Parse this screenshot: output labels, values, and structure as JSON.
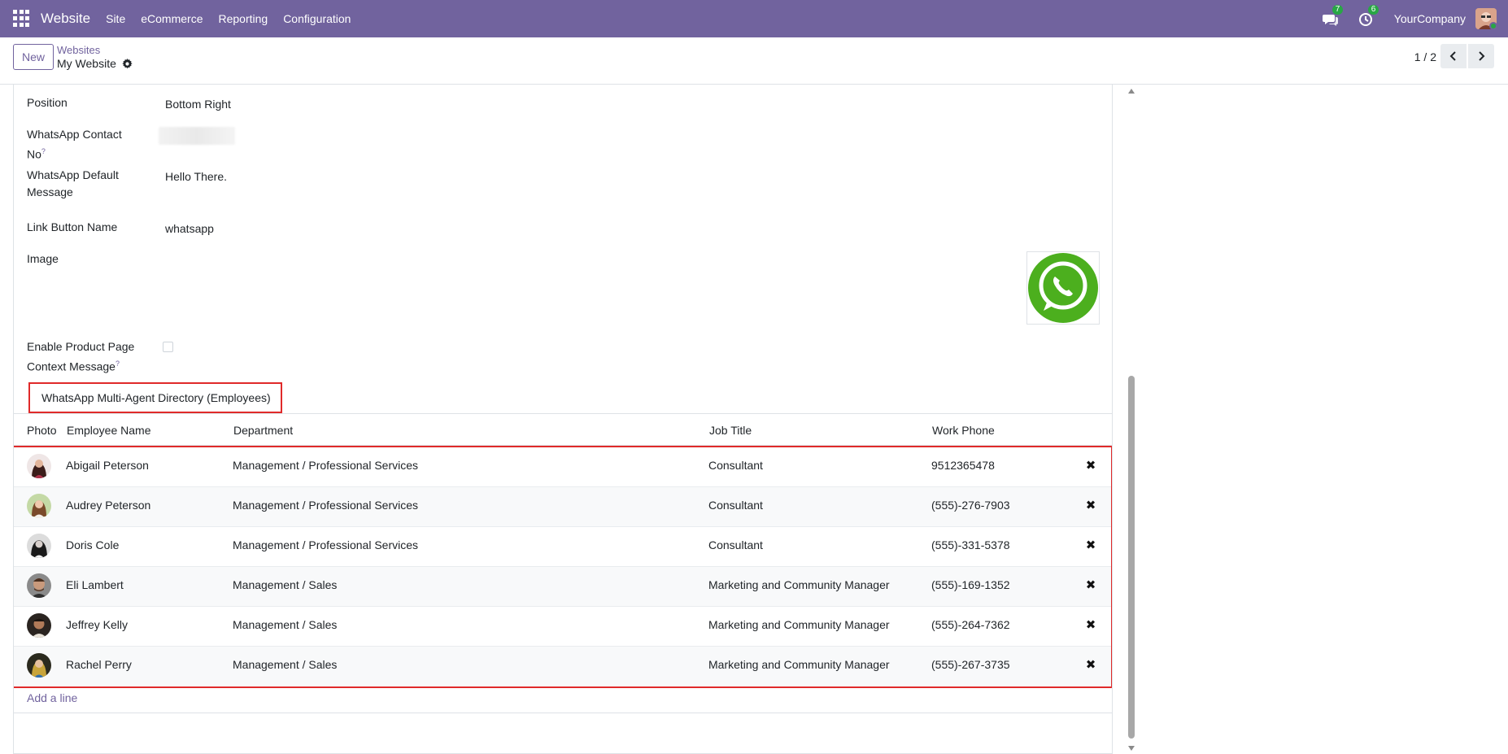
{
  "navbar": {
    "brand": "Website",
    "menu": [
      "Site",
      "eCommerce",
      "Reporting",
      "Configuration"
    ],
    "messages_badge": "7",
    "activities_badge": "6",
    "company": "YourCompany",
    "bg_color": "#71639e"
  },
  "control_panel": {
    "new_label": "New",
    "breadcrumb": "Websites",
    "record_title": "My Website",
    "pager": "1 / 2"
  },
  "form": {
    "position_label": "Position",
    "position_value": "Bottom Right",
    "contact_label": "WhatsApp Contact No",
    "contact_help": "?",
    "default_msg_label": "WhatsApp Default Message",
    "default_msg_value": "Hello There.",
    "link_name_label": "Link Button Name",
    "link_name_value": "whatsapp",
    "image_label": "Image",
    "product_msg_label": "Enable Product Page Context Message",
    "product_msg_help": "?",
    "section_title": "WhatsApp Multi-Agent Directory (Employees)"
  },
  "table": {
    "headers": {
      "photo": "Photo",
      "name": "Employee Name",
      "department": "Department",
      "job": "Job Title",
      "phone": "Work Phone"
    },
    "rows": [
      {
        "name": "Abigail Peterson",
        "department": "Management / Professional Services",
        "job": "Consultant",
        "phone": "9512365478"
      },
      {
        "name": "Audrey Peterson",
        "department": "Management / Professional Services",
        "job": "Consultant",
        "phone": "(555)-276-7903"
      },
      {
        "name": "Doris Cole",
        "department": "Management / Professional Services",
        "job": "Consultant",
        "phone": "(555)-331-5378"
      },
      {
        "name": "Eli Lambert",
        "department": "Management / Sales",
        "job": "Marketing and Community Manager",
        "phone": "(555)-169-1352"
      },
      {
        "name": "Jeffrey Kelly",
        "department": "Management / Sales",
        "job": "Marketing and Community Manager",
        "phone": "(555)-264-7362"
      },
      {
        "name": "Rachel Perry",
        "department": "Management / Sales",
        "job": "Marketing and Community Manager",
        "phone": "(555)-267-3735"
      }
    ],
    "add_line": "Add a line"
  }
}
